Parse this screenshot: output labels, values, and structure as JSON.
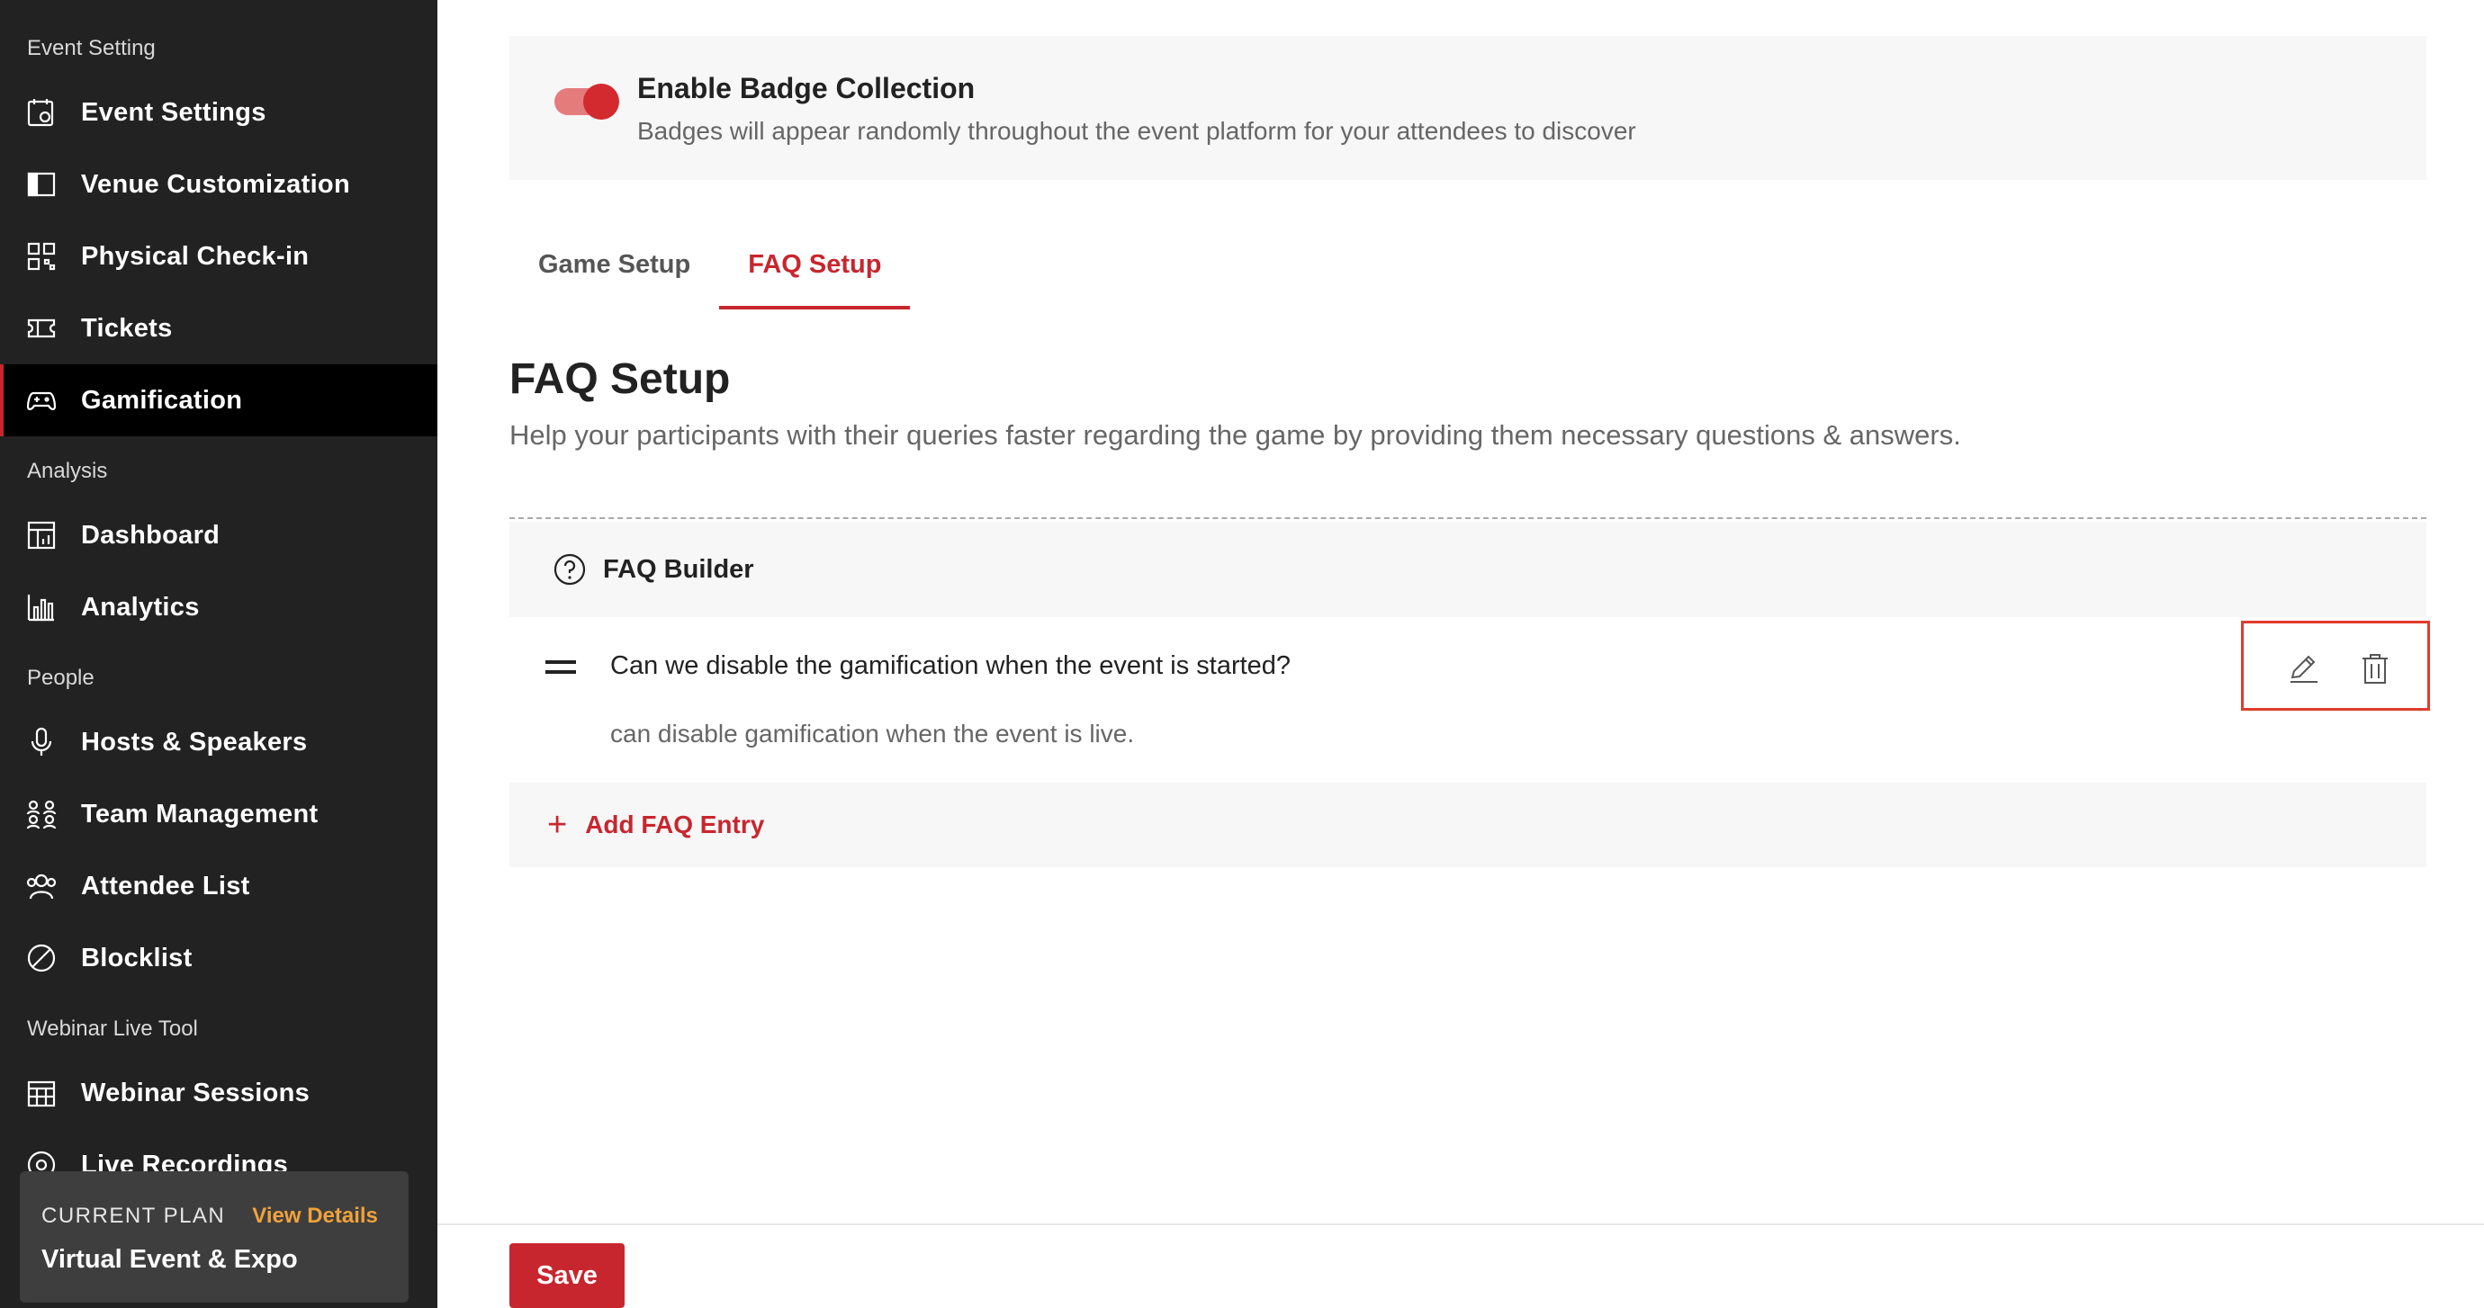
{
  "sidebar": {
    "sections": [
      {
        "title": "Event Setting"
      },
      {
        "title": "Analysis"
      },
      {
        "title": "People"
      },
      {
        "title": "Webinar Live Tool"
      }
    ],
    "items": [
      {
        "label": "Event Settings",
        "icon": "calendar-gear-icon"
      },
      {
        "label": "Venue Customization",
        "icon": "layout-icon"
      },
      {
        "label": "Physical Check-in",
        "icon": "qr-code-icon"
      },
      {
        "label": "Tickets",
        "icon": "ticket-icon"
      },
      {
        "label": "Gamification",
        "icon": "gamepad-icon",
        "active": true
      },
      {
        "label": "Dashboard",
        "icon": "dashboard-icon"
      },
      {
        "label": "Analytics",
        "icon": "bar-chart-icon"
      },
      {
        "label": "Hosts & Speakers",
        "icon": "microphone-icon"
      },
      {
        "label": "Team Management",
        "icon": "team-icon"
      },
      {
        "label": "Attendee List",
        "icon": "users-icon"
      },
      {
        "label": "Blocklist",
        "icon": "block-icon"
      },
      {
        "label": "Webinar Sessions",
        "icon": "calendar-grid-icon"
      },
      {
        "label": "Live Recordings",
        "icon": "record-icon"
      }
    ],
    "plan": {
      "label": "CURRENT PLAN",
      "link": "View Details",
      "name": "Virtual Event & Expo"
    }
  },
  "badge": {
    "enabled": true,
    "title": "Enable Badge Collection",
    "description": "Badges will appear randomly throughout the event platform for your attendees to discover"
  },
  "tabs": [
    {
      "label": "Game Setup",
      "active": false
    },
    {
      "label": "FAQ Setup",
      "active": true
    }
  ],
  "page": {
    "title": "FAQ Setup",
    "description": "Help your participants with their queries faster regarding the game by providing them necessary questions & answers."
  },
  "builder": {
    "title": "FAQ Builder",
    "entries": [
      {
        "question": "Can we disable the gamification when the event is started?",
        "answer": "can disable gamification when the event is live."
      }
    ],
    "add_label": "Add FAQ Entry"
  },
  "footer": {
    "save_label": "Save"
  },
  "colors": {
    "accent": "#c8262e",
    "sidebar_bg": "#222222",
    "highlight_border": "#e03c2c",
    "plan_link": "#f0a23a"
  }
}
